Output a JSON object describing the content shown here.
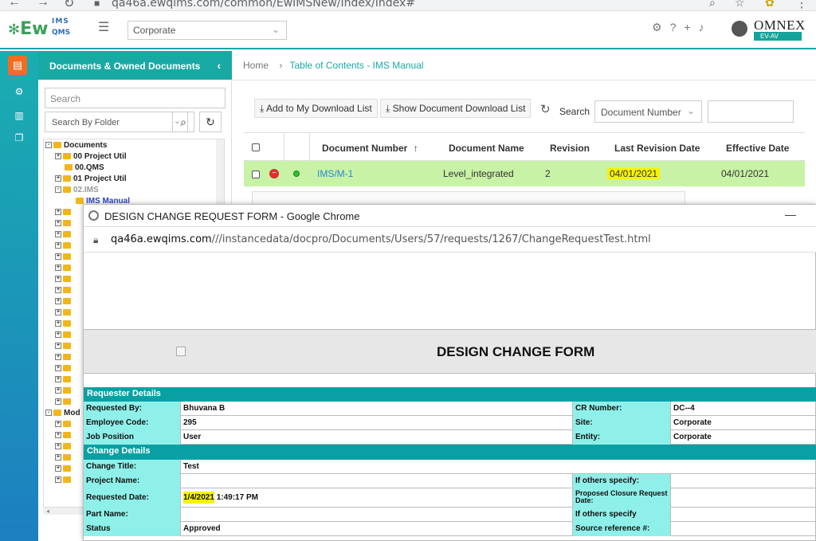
{
  "browser": {
    "url": "qa46a.ewqims.com/common/EwIMSNew/Index/Index#"
  },
  "header": {
    "logo": "Ew",
    "logo_top": "IMS",
    "logo_bottom": "QMS",
    "site_selector": "Corporate",
    "brand": "OMNEX",
    "brand_badge": "EV-AV"
  },
  "sidebar": {
    "title": "Documents & Owned Documents",
    "search_placeholder": "Search",
    "folder_select": "Search By Folder",
    "tree": [
      {
        "label": "Documents"
      },
      {
        "label": "00 Project Util"
      },
      {
        "label": "00.QMS"
      },
      {
        "label": "01 Project Util"
      },
      {
        "label": "02.IMS"
      },
      {
        "label": "IMS Manual"
      },
      {
        "label": "Mod"
      }
    ]
  },
  "main": {
    "breadcrumb_home": "Home",
    "breadcrumb_current": "Table of Contents - IMS Manual",
    "add_download_label": "Add to My Download List",
    "show_download_label": "Show Document Download List",
    "search_label": "Search",
    "search_field_select": "Document Number",
    "columns": [
      "Document Number",
      "Document Name",
      "Revision",
      "Last Revision Date",
      "Effective Date"
    ],
    "sort_indicator": "↑",
    "row": {
      "doc_number": "IMS/M-1",
      "doc_name": "Level_integrated",
      "revision": "2",
      "last_revision_date": "04/01/2021",
      "effective_date": "04/01/2021"
    }
  },
  "popup": {
    "window_title": "DESIGN CHANGE REQUEST FORM - Google Chrome",
    "address_host": "qa46a.ewqims.com",
    "address_path": "///instancedata/docpro/Documents/Users/57/requests/1267/ChangeRequestTest.html",
    "form_title": "DESIGN CHANGE FORM",
    "requester_section": "Requester Details",
    "requested_by_label": "Requested By:",
    "requested_by": "Bhuvana B",
    "cr_number_label": "CR Number:",
    "cr_number": "DC--4",
    "employee_code_label": "Employee Code:",
    "employee_code": "295",
    "site_label": "Site:",
    "site": "Corporate",
    "job_position_label": "Job Position",
    "job_position": "User",
    "entity_label": "Entity:",
    "entity": "Corporate",
    "change_section": "Change Details",
    "change_title_label": "Change Title:",
    "change_title": "Test",
    "project_name_label": "Project Name:",
    "if_others_label": "If others specify:",
    "requested_date_label": "Requested Date:",
    "requested_date_highlight": "1/4/2021",
    "requested_date_rest": " 1:49:17 PM",
    "proposed_closure_label": "Proposed Closure Request Date:",
    "part_name_label": "Part Name:",
    "if_others_label2": "If others specify",
    "status_label": "Status",
    "status": "Approved",
    "source_ref_label": "Source reference #:"
  },
  "colors": {
    "teal": "#19a9a4",
    "row_green": "#c8f2a5",
    "highlight": "#f7f300",
    "label_cyan": "#8ff0ea"
  }
}
